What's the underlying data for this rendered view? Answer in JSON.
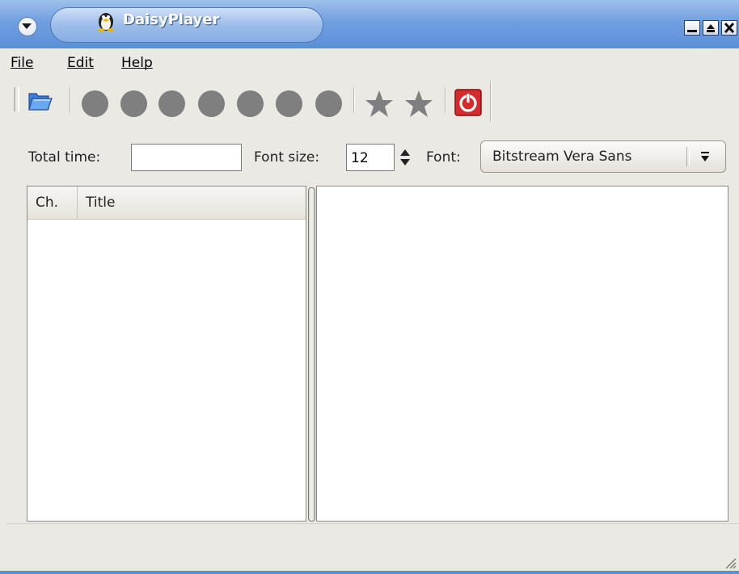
{
  "window": {
    "title": "DaisyPlayer",
    "icons": [
      "window-menu-icon",
      "tux-icon",
      "minimize-icon",
      "maximize-icon",
      "close-icon"
    ]
  },
  "menubar": {
    "items": [
      {
        "label": "File"
      },
      {
        "label": "Edit"
      },
      {
        "label": "Help"
      }
    ]
  },
  "toolbar": {
    "icons": [
      "open-folder-icon",
      "circle-icon",
      "circle-icon",
      "circle-icon",
      "circle-icon",
      "circle-icon",
      "circle-icon",
      "circle-icon",
      "star-icon",
      "star-icon",
      "power-icon"
    ]
  },
  "controls": {
    "total_time_label": "Total time:",
    "total_time_value": "",
    "font_size_label": "Font size:",
    "font_size_value": "12",
    "font_label": "Font:",
    "font_value": "Bitstream Vera Sans"
  },
  "chapter_list": {
    "columns": [
      "Ch.",
      "Title"
    ],
    "rows": []
  },
  "colors": {
    "titlebar": "#5d8fd8",
    "window_bg": "#ebe9e4",
    "icon_gray": "#7f7f7f",
    "power_red": "#d42c2c"
  }
}
